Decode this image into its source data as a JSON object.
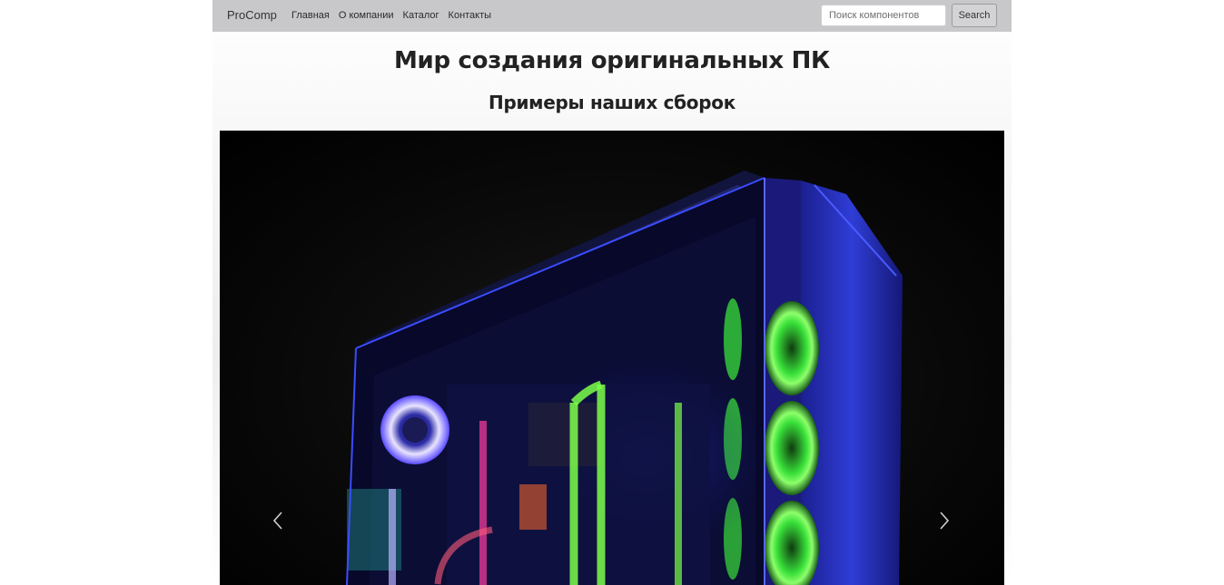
{
  "navbar": {
    "brand": "ProComp",
    "links": [
      "Главная",
      "О компании",
      "Каталог",
      "Контакты"
    ],
    "search_placeholder": "Поиск компонентов",
    "search_button": "Search"
  },
  "main": {
    "title": "Мир создания оригинальных ПК",
    "subtitle": "Примеры наших сборок"
  },
  "carousel": {
    "image": "custom-water-cooled-pc-build",
    "prev_icon": "chevron-left-icon",
    "next_icon": "chevron-right-icon"
  },
  "colors": {
    "navbar_bg": "#c8c8ca",
    "accent_blue": "#2a3cff",
    "accent_green": "#49ff3a",
    "accent_red": "#ff2a5a"
  }
}
